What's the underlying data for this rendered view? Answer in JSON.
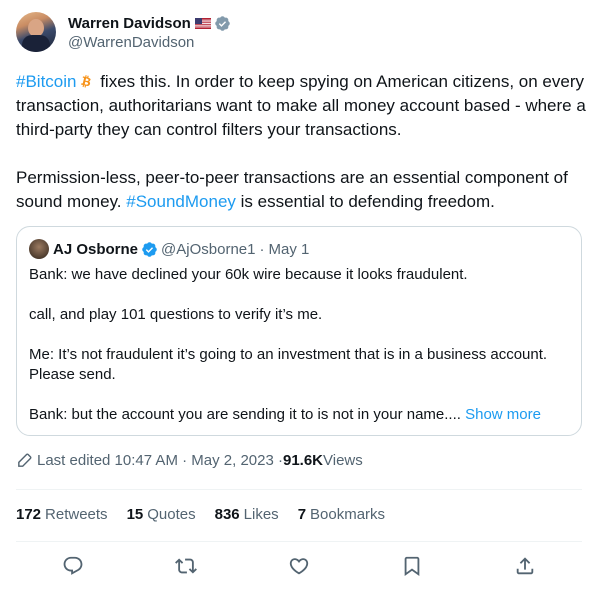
{
  "author": {
    "display_name": "Warren Davidson",
    "handle": "@WarrenDavidson",
    "flag": "🇺🇸"
  },
  "tweet": {
    "line1_hashtag": "#Bitcoin",
    "line1_rest": " fixes this. In order to keep spying on American citizens, on every transaction, authoritarians want to make all money account based - where a third-party they can control filters your transactions.",
    "line2_start": "Permission-less, peer-to-peer transactions are an essential component of sound money. ",
    "line2_hashtag": "#SoundMoney",
    "line2_end": " is essential to defending freedom."
  },
  "quote": {
    "name": "AJ Osborne",
    "handle": "@AjOsborne1",
    "separator": "·",
    "date": "May 1",
    "paragraphs": [
      "Bank: we have declined your 60k wire because it looks fraudulent.",
      "call, and play 101 questions to verify it’s me.",
      "Me: It’s not fraudulent it’s going to an investment that is in a business account. Please send."
    ],
    "last_line": "Bank: but the account you are sending it to is not in your name.... ",
    "show_more": "Show more"
  },
  "meta": {
    "edited": "Last edited 10:47 AM · May 2, 2023 · ",
    "views_count": "91.6K",
    "views_label": " Views"
  },
  "stats": [
    {
      "count": "172",
      "label": "Retweets"
    },
    {
      "count": "15",
      "label": "Quotes"
    },
    {
      "count": "836",
      "label": "Likes"
    },
    {
      "count": "7",
      "label": "Bookmarks"
    }
  ],
  "colors": {
    "accent": "#1d9bf0",
    "secondary_text": "#536471",
    "bitcoin": "#f7931a"
  },
  "icons": [
    "verified-badge-icon",
    "bitcoin-icon",
    "edit-icon",
    "reply-icon",
    "retweet-icon",
    "like-icon",
    "bookmark-icon",
    "share-icon"
  ]
}
